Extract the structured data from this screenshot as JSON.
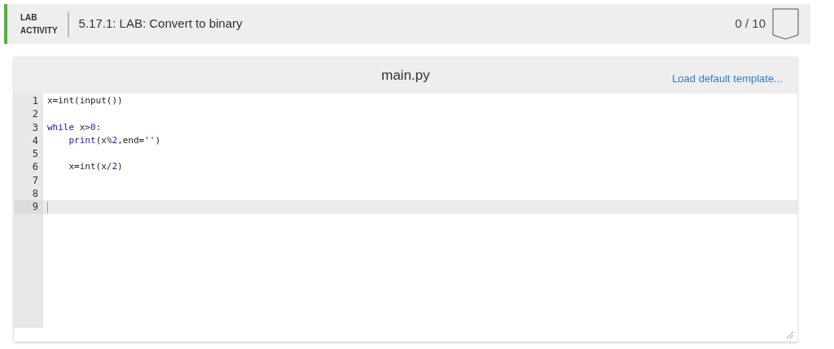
{
  "header": {
    "label_lines": [
      "LAB",
      "ACTIVITY"
    ],
    "title": "5.17.1: LAB: Convert to binary",
    "score": "0 / 10"
  },
  "editor": {
    "filename": "main.py",
    "template_link": "Load default template...",
    "lines": [
      {
        "number": "1",
        "active": false,
        "tokens": [
          {
            "kind": "plain",
            "text": "x=int(input())"
          }
        ]
      },
      {
        "number": "2",
        "active": false
      },
      {
        "number": "3",
        "active": false,
        "tokens": [
          {
            "kind": "keyword",
            "text": "while"
          },
          {
            "kind": "plain",
            "text": " x>"
          },
          {
            "kind": "number",
            "text": "0"
          },
          {
            "kind": "plain",
            "text": ":"
          }
        ]
      },
      {
        "number": "4",
        "active": false,
        "indented": true,
        "tokens": [
          {
            "kind": "keyword",
            "text": "print"
          },
          {
            "kind": "plain",
            "text": "(x"
          },
          {
            "kind": "keyword",
            "text": "%2"
          },
          {
            "kind": "plain",
            "text": ",end="
          },
          {
            "kind": "keyword",
            "text": "''"
          },
          {
            "kind": "plain",
            "text": ")"
          }
        ]
      },
      {
        "number": "5",
        "active": false
      },
      {
        "number": "6",
        "active": false,
        "indented": true,
        "tokens": [
          {
            "kind": "plain",
            "text": "x=int(x"
          },
          {
            "kind": "keyword",
            "text": "/2"
          },
          {
            "kind": "plain",
            "text": ")"
          }
        ]
      },
      {
        "number": "7",
        "active": false
      },
      {
        "number": "8",
        "active": false
      },
      {
        "number": "9",
        "active": true
      }
    ]
  }
}
